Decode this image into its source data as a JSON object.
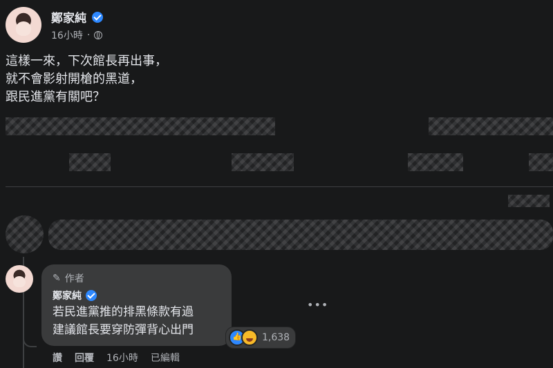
{
  "post": {
    "author": "鄭家純",
    "time": "16小時",
    "lines": [
      "這樣一來，下次館長再出事，",
      "就不會影射開槍的黑道，",
      "跟民進黨有關吧？"
    ]
  },
  "reply": {
    "author_tag": "作者",
    "author": "鄭家純",
    "lines": [
      "若民進黨推的排黑條款有過",
      "建議館長要穿防彈背心出門"
    ],
    "reaction_count": "1,638",
    "actions": {
      "like": "讚",
      "reply": "回覆",
      "time": "16小時",
      "edited": "已編輯"
    }
  },
  "icons": {
    "verified": "verified-badge-icon",
    "audience": "globe-icon",
    "author_tag": "pencil-icon",
    "more": "more-options-icon",
    "reactions": [
      "like-reaction-icon",
      "haha-reaction-icon"
    ]
  },
  "colors": {
    "background": "#18191a",
    "bubble": "#3a3b3c",
    "verified": "#2d88ff",
    "secondary_text": "#b0b3b8"
  }
}
